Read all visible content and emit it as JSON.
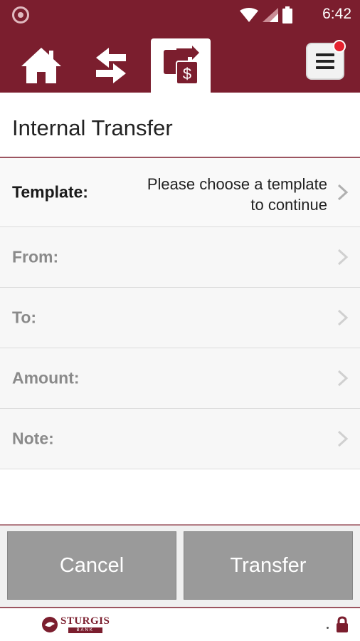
{
  "status_bar": {
    "time": "6:42",
    "icons": [
      "notification-circle-icon",
      "wifi-icon",
      "signal-icon",
      "battery-icon"
    ]
  },
  "nav": {
    "tabs": [
      {
        "name": "home-icon",
        "active": false
      },
      {
        "name": "transfer-arrows-icon",
        "active": false
      },
      {
        "name": "transfer-money-icon",
        "active": true
      }
    ],
    "menu_icon": "menu-icon",
    "notification_badge": true
  },
  "page": {
    "title": "Internal Transfer"
  },
  "form": {
    "template": {
      "label": "Template:",
      "value_line1": "Please choose a template",
      "value_line2": "to continue"
    },
    "from": {
      "label": "From:"
    },
    "to": {
      "label": "To:"
    },
    "amount": {
      "label": "Amount:"
    },
    "note": {
      "label": "Note:"
    }
  },
  "actions": {
    "cancel_label": "Cancel",
    "transfer_label": "Transfer"
  },
  "footer": {
    "logo_name": "STURGIS",
    "logo_sub": "BANK"
  },
  "colors": {
    "brand": "#7b1e2e",
    "button_gray": "#9a9a9a",
    "badge_red": "#e5222f"
  }
}
